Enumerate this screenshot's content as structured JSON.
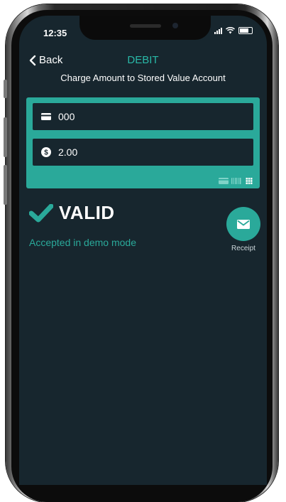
{
  "status_bar": {
    "time": "12:35"
  },
  "nav": {
    "back_label": "Back",
    "title": "DEBIT"
  },
  "subtitle": "Charge Amount to Stored Value Account",
  "form": {
    "card_field": {
      "icon": "card-icon",
      "value": "000"
    },
    "amount_field": {
      "icon": "dollar-icon",
      "value": "2.00"
    },
    "input_modes": [
      "card-swipe-icon",
      "barcode-icon",
      "keypad-icon"
    ]
  },
  "result": {
    "status": "VALID",
    "message": "Accepted in demo mode",
    "receipt_label": "Receipt"
  },
  "colors": {
    "accent": "#2aa99a",
    "background": "#17262e",
    "text": "#ffffff"
  }
}
